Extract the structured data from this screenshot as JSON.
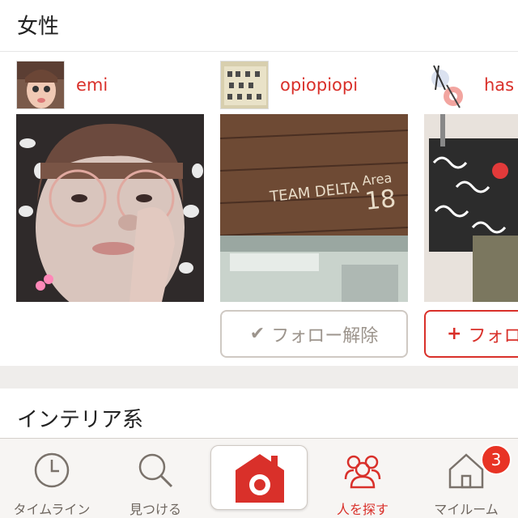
{
  "sections": {
    "women": {
      "title": "女性"
    },
    "interior": {
      "title": "インテリア系"
    }
  },
  "users": [
    {
      "name": "emi",
      "avatar": "woman-face-photo",
      "photo": "woman-with-glasses-selfie"
    },
    {
      "name": "opiopiopi",
      "avatar": "letter-board-photo",
      "photo": "team-delta-sign-photo",
      "follow_label": "フォロー解除",
      "follow_state": "following",
      "follow_icon": "checkmark-icon"
    },
    {
      "name": "has",
      "avatar": "earrings-photo",
      "photo": "suitcases-photo",
      "follow_label": "フォロ",
      "follow_state": "not-following",
      "follow_icon": "plus-icon"
    }
  ],
  "tabbar": {
    "timeline": "タイムライン",
    "discover": "見つける",
    "camera": "camera-icon",
    "people": "人を探す",
    "myroom": "マイルーム",
    "myroom_badge": "3"
  },
  "colors": {
    "accent": "#d9302a",
    "tab_inactive": "#6f6760",
    "badge": "#e83324"
  }
}
